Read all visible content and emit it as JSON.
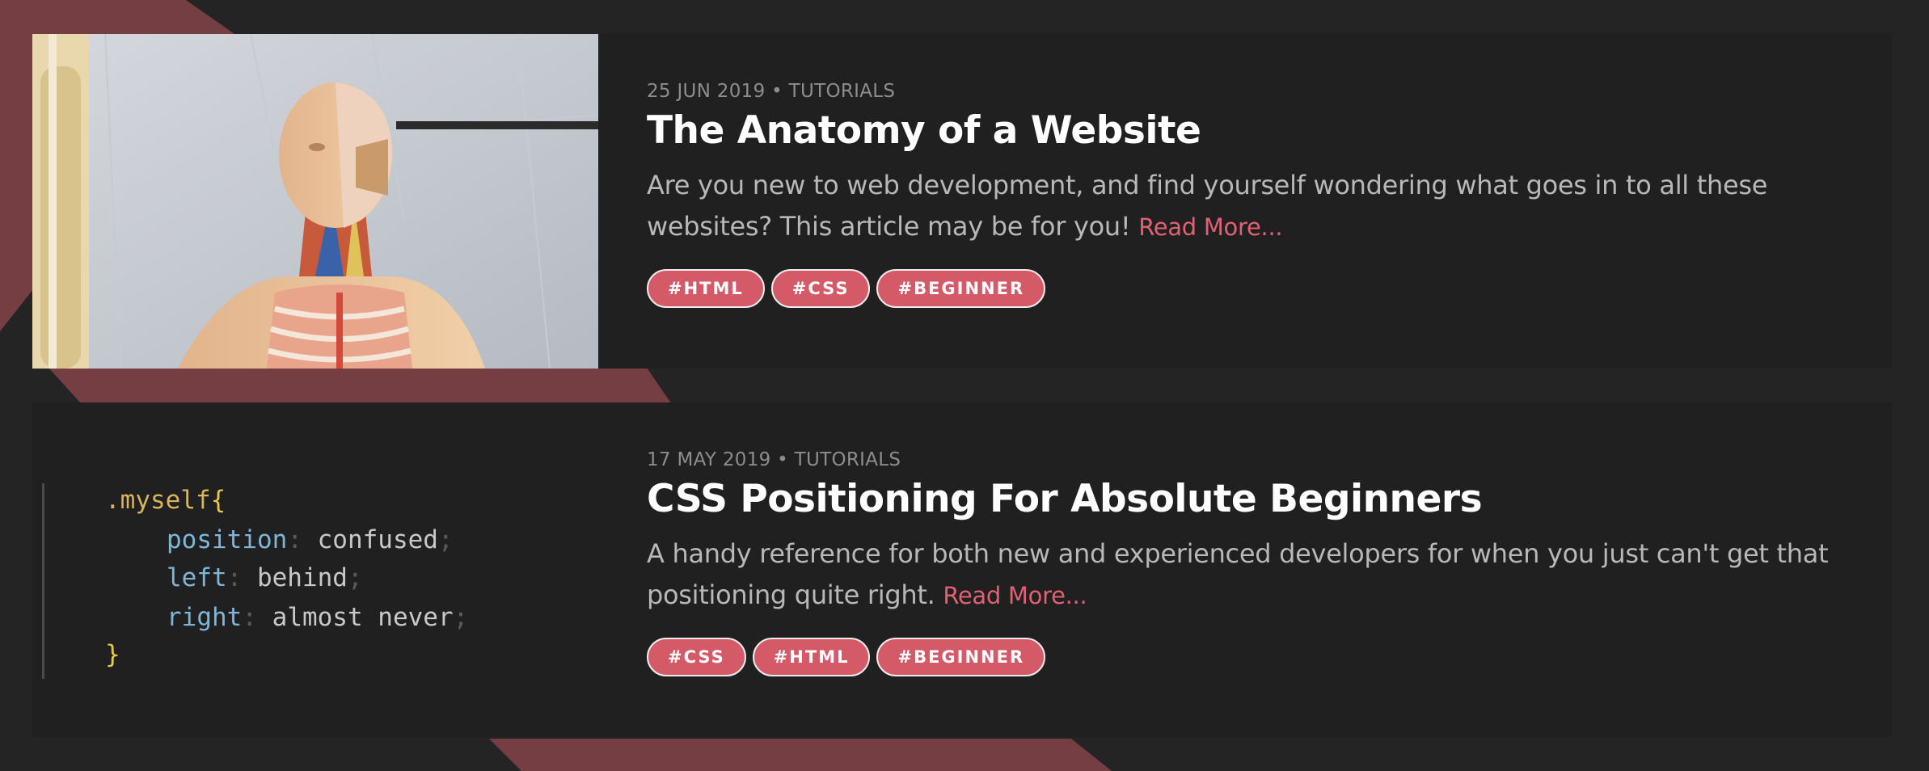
{
  "posts": [
    {
      "meta": "25 JUN 2019 • TUTORIALS",
      "title": "The Anatomy of a Website",
      "excerpt": "Are you new to web development, and find yourself wondering what goes in to all these websites? This article may be for you!",
      "read_more": "Read More...",
      "tags": [
        "#HTML",
        "#CSS",
        "#BEGINNER"
      ]
    },
    {
      "meta": "17 MAY 2019 • TUTORIALS",
      "title": "CSS Positioning For Absolute Beginners",
      "excerpt": "A handy reference for both new and experienced developers for when you just can't get that positioning quite right.",
      "read_more": "Read More...",
      "tags": [
        "#CSS",
        "#HTML",
        "#BEGINNER"
      ],
      "code_image": {
        "selector": ".myself",
        "open_brace": "{",
        "close_brace": "}",
        "lines": [
          {
            "prop": "position",
            "value": "confused"
          },
          {
            "prop": "left",
            "value": "behind"
          },
          {
            "prop": "right",
            "value": "almost never"
          }
        ]
      }
    }
  ],
  "colors": {
    "accent": "#d55a68",
    "link": "#e06173",
    "decor": "#753e43",
    "card_bg": "#202020",
    "page_bg": "#242424"
  }
}
